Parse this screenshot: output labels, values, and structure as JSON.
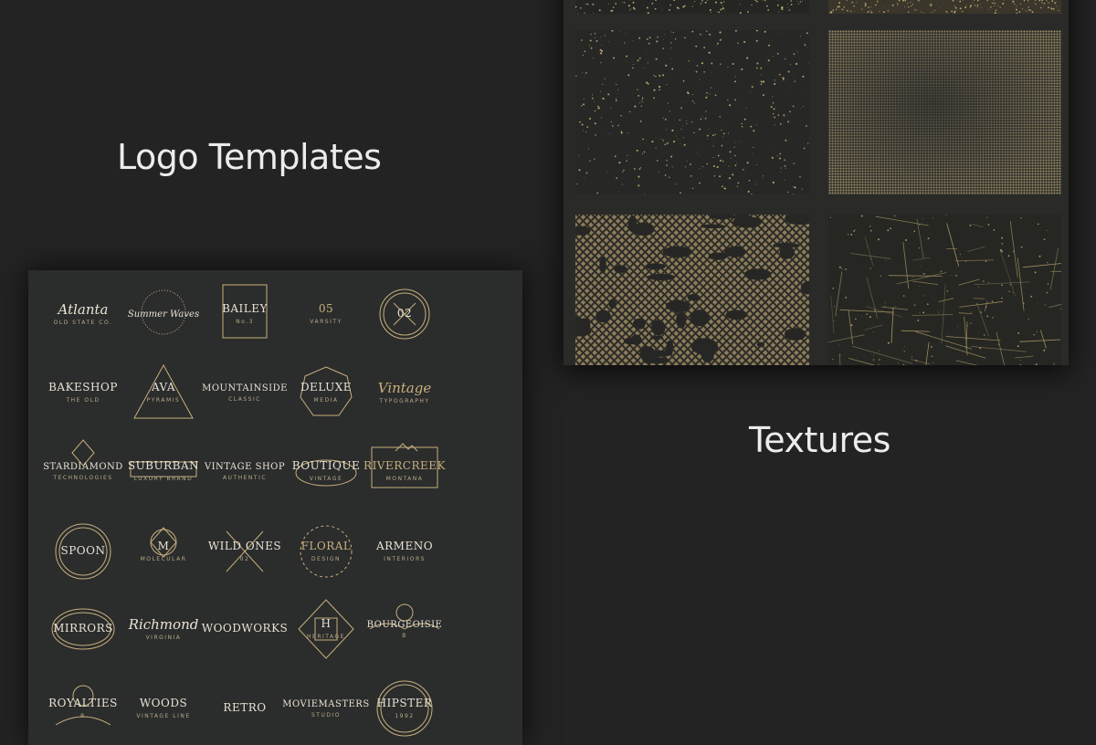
{
  "headings": {
    "logo_templates": "Logo Templates",
    "textures": "Textures"
  },
  "colors": {
    "background": "#232323",
    "sheet": "#2b2c2c",
    "gold": "#c7b07d",
    "cream": "#e9e3d4"
  },
  "logos": [
    {
      "title": "Atlanta",
      "sub": "OLD STATE CO.",
      "icon": "script-badge"
    },
    {
      "title": "Summer Waves",
      "sub": "",
      "icon": "sunburst"
    },
    {
      "title": "BAILEY",
      "sub": "No.3",
      "icon": "frame-box"
    },
    {
      "title": "05",
      "sub": "VARSITY",
      "icon": "laurel"
    },
    {
      "title": "02",
      "sub": "",
      "icon": "circle-cross"
    },
    {
      "title": "BAKESHOP",
      "sub": "THE OLD",
      "icon": "cupcake"
    },
    {
      "title": "AVA",
      "sub": "PYRAMIS",
      "icon": "triangle"
    },
    {
      "title": "MOUNTAINSIDE",
      "sub": "CLASSIC",
      "icon": "trees"
    },
    {
      "title": "DELUXE",
      "sub": "MEDIA",
      "icon": "circle"
    },
    {
      "title": "Vintage",
      "sub": "TYPOGRAPHY",
      "icon": "script"
    },
    {
      "title": "STARDIAMOND",
      "sub": "TECHNOLOGIES",
      "icon": "diamond"
    },
    {
      "title": "SUBURBAN",
      "sub": "LUXURY BRAND",
      "icon": "frame-line"
    },
    {
      "title": "VINTAGE SHOP",
      "sub": "AUTHENTIC",
      "icon": "mountain"
    },
    {
      "title": "BOUTIQUE",
      "sub": "VINTAGE",
      "icon": "oval"
    },
    {
      "title": "RIVERCREEK",
      "sub": "MONTANA",
      "icon": "mountain-frame"
    },
    {
      "title": "SPOON",
      "sub": "",
      "icon": "ring"
    },
    {
      "title": "M",
      "sub": "MOLECULAR",
      "icon": "geometric"
    },
    {
      "title": "WILD ONES",
      "sub": "02",
      "icon": "arrows"
    },
    {
      "title": "FLORAL",
      "sub": "DESIGN",
      "icon": "wreath"
    },
    {
      "title": "ARMENO",
      "sub": "INTERIORS",
      "icon": "ornament"
    },
    {
      "title": "MIRRORS",
      "sub": "",
      "icon": "ornate-frame"
    },
    {
      "title": "Richmond",
      "sub": "VIRGINIA",
      "icon": "ribbon"
    },
    {
      "title": "WOODWORKS",
      "sub": "",
      "icon": "barrel"
    },
    {
      "title": "H",
      "sub": "HERITAGE",
      "icon": "monogram"
    },
    {
      "title": "BOURGEOISIE",
      "sub": "B",
      "icon": "flourish"
    },
    {
      "title": "ROYALTIES",
      "sub": "R",
      "icon": "crest"
    },
    {
      "title": "WOODS",
      "sub": "VINTAGE LINE",
      "icon": "axe"
    },
    {
      "title": "RETRO",
      "sub": "",
      "icon": "scissors"
    },
    {
      "title": "MOVIEMASTERS",
      "sub": "STUDIO",
      "icon": "bicycle"
    },
    {
      "title": "HIPSTER",
      "sub": "1992",
      "icon": "cassette"
    }
  ],
  "textures": [
    {
      "name": "speckle"
    },
    {
      "name": "halftone"
    },
    {
      "name": "crosshatch"
    },
    {
      "name": "scratches"
    }
  ]
}
